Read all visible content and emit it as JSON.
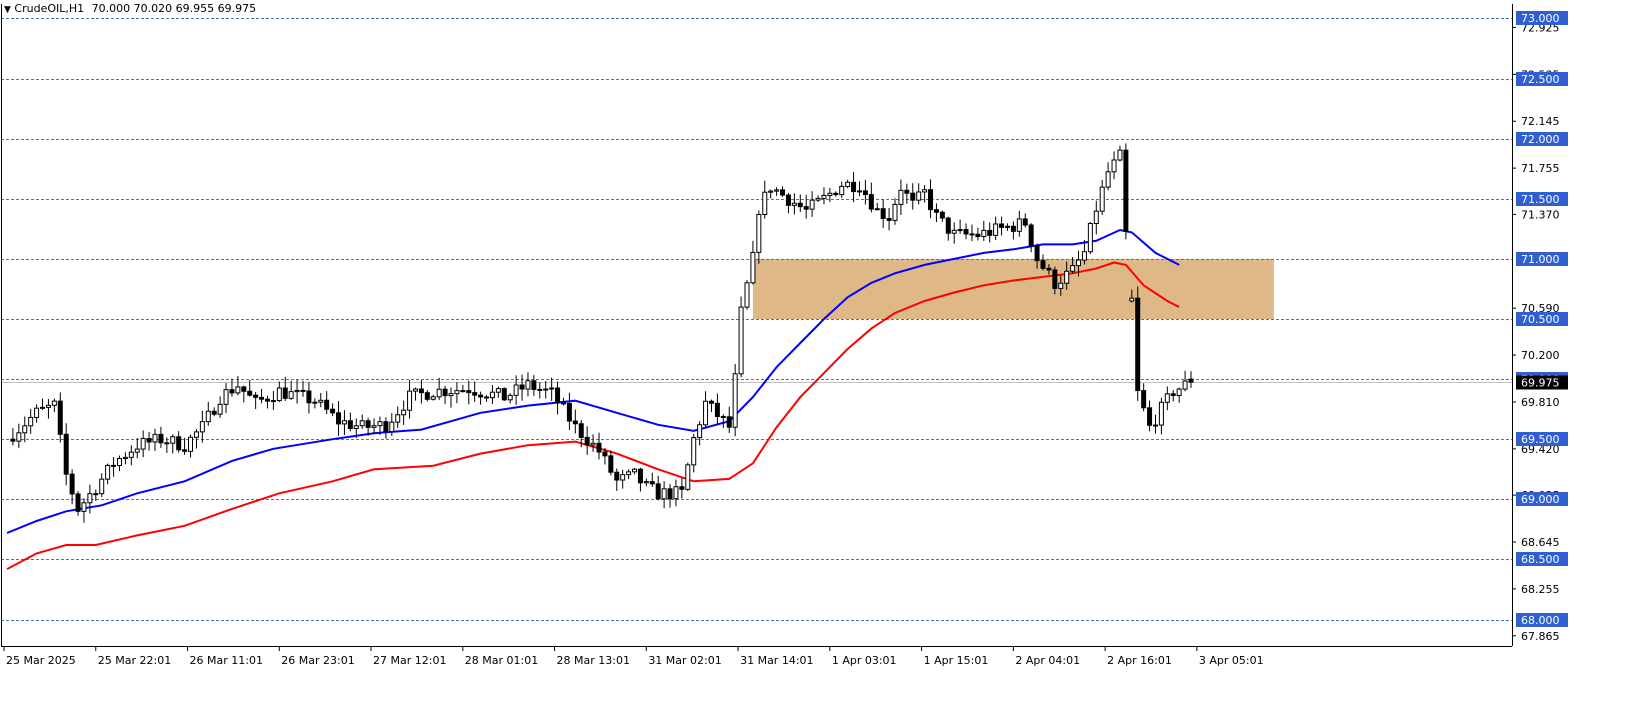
{
  "header": {
    "menu_icon": "triangle-down-icon",
    "symbol": "CrudeOIL,H1",
    "ohlc": "70.000 70.020 69.955 69.975"
  },
  "colors": {
    "background": "#ffffff",
    "grid": "#4472c4",
    "price_label_bg": "#2f5fd0",
    "bull": "#ffffff",
    "bear": "#000000",
    "ema_fast": "#0000ff",
    "ema_slow": "#ff0000",
    "zone": "#deb887"
  },
  "chart_data": {
    "type": "candlestick",
    "symbol": "CrudeOIL",
    "timeframe": "H1",
    "ylim": [
      67.78,
      73.12
    ],
    "grid_levels": [
      73.0,
      72.5,
      72.0,
      71.5,
      71.0,
      70.5,
      70.0,
      69.5,
      69.0,
      68.5,
      68.0
    ],
    "y_ticks": [
      "72.925",
      "72.535",
      "72.145",
      "71.755",
      "71.370",
      "70.590",
      "70.200",
      "69.810",
      "69.420",
      "69.035",
      "68.645",
      "68.255",
      "67.865"
    ],
    "current_price": 69.975,
    "x_ticks": [
      "25 Mar 2025",
      "25 Mar 22:01",
      "26 Mar 11:01",
      "26 Mar 23:01",
      "27 Mar 12:01",
      "28 Mar 01:01",
      "28 Mar 13:01",
      "31 Mar 02:01",
      "31 Mar 14:01",
      "1 Apr 03:01",
      "1 Apr 15:01",
      "2 Apr 04:01",
      "2 Apr 16:01",
      "3 Apr 05:01"
    ],
    "zone": {
      "from_bar": 126,
      "to_bar": 214,
      "low": 70.5,
      "high": 71.0
    },
    "gap_bars": [
      190
    ],
    "waypoints": [
      [
        0,
        69.5
      ],
      [
        5,
        69.72
      ],
      [
        8,
        69.78
      ],
      [
        10,
        69.2
      ],
      [
        12,
        68.92
      ],
      [
        15,
        69.1
      ],
      [
        18,
        69.3
      ],
      [
        22,
        69.45
      ],
      [
        26,
        69.5
      ],
      [
        30,
        69.45
      ],
      [
        33,
        69.6
      ],
      [
        36,
        69.85
      ],
      [
        39,
        69.95
      ],
      [
        42,
        69.8
      ],
      [
        46,
        69.9
      ],
      [
        52,
        69.82
      ],
      [
        56,
        69.65
      ],
      [
        60,
        69.6
      ],
      [
        64,
        69.62
      ],
      [
        68,
        69.85
      ],
      [
        72,
        69.9
      ],
      [
        78,
        69.92
      ],
      [
        84,
        69.85
      ],
      [
        88,
        69.95
      ],
      [
        92,
        69.88
      ],
      [
        96,
        69.6
      ],
      [
        100,
        69.4
      ],
      [
        103,
        69.15
      ],
      [
        106,
        69.2
      ],
      [
        108,
        69.1
      ],
      [
        110,
        69.05
      ],
      [
        114,
        69.05
      ],
      [
        116,
        69.5
      ],
      [
        118,
        69.8
      ],
      [
        120,
        69.7
      ],
      [
        122,
        69.6
      ],
      [
        123,
        70.0
      ],
      [
        124,
        70.55
      ],
      [
        126,
        71.0
      ],
      [
        127,
        71.42
      ],
      [
        129,
        71.6
      ],
      [
        132,
        71.5
      ],
      [
        135,
        71.4
      ],
      [
        138,
        71.5
      ],
      [
        141,
        71.62
      ],
      [
        144,
        71.62
      ],
      [
        147,
        71.4
      ],
      [
        149,
        71.35
      ],
      [
        151,
        71.6
      ],
      [
        153,
        71.45
      ],
      [
        155,
        71.55
      ],
      [
        157,
        71.35
      ],
      [
        160,
        71.2
      ],
      [
        164,
        71.2
      ],
      [
        168,
        71.25
      ],
      [
        172,
        71.3
      ],
      [
        174,
        71.0
      ],
      [
        177,
        70.8
      ],
      [
        180,
        70.9
      ],
      [
        182,
        71.05
      ],
      [
        184,
        71.42
      ],
      [
        186,
        71.72
      ],
      [
        188,
        71.85
      ],
      [
        189,
        71.2
      ],
      [
        190,
        70.65
      ],
      [
        191,
        69.88
      ],
      [
        193,
        69.6
      ],
      [
        195,
        69.75
      ],
      [
        197,
        69.9
      ],
      [
        200,
        69.975
      ]
    ],
    "ema": [
      {
        "name": "",
        "color": "#0000ff",
        "points": [
          [
            0,
            68.72
          ],
          [
            5,
            68.82
          ],
          [
            10,
            68.9
          ],
          [
            16,
            68.95
          ],
          [
            22,
            69.05
          ],
          [
            30,
            69.15
          ],
          [
            38,
            69.32
          ],
          [
            45,
            69.42
          ],
          [
            55,
            69.5
          ],
          [
            62,
            69.55
          ],
          [
            70,
            69.58
          ],
          [
            80,
            69.72
          ],
          [
            88,
            69.78
          ],
          [
            96,
            69.82
          ],
          [
            103,
            69.72
          ],
          [
            110,
            69.62
          ],
          [
            116,
            69.57
          ],
          [
            122,
            69.65
          ],
          [
            126,
            69.85
          ],
          [
            130,
            70.1
          ],
          [
            134,
            70.3
          ],
          [
            138,
            70.5
          ],
          [
            142,
            70.68
          ],
          [
            146,
            70.8
          ],
          [
            150,
            70.88
          ],
          [
            155,
            70.95
          ],
          [
            160,
            71.0
          ],
          [
            165,
            71.05
          ],
          [
            170,
            71.08
          ],
          [
            175,
            71.12
          ],
          [
            180,
            71.12
          ],
          [
            184,
            71.15
          ],
          [
            188,
            71.24
          ],
          [
            190,
            71.22
          ],
          [
            194,
            71.05
          ],
          [
            198,
            70.95
          ]
        ]
      },
      {
        "name": "",
        "color": "#ff0000",
        "points": [
          [
            0,
            68.42
          ],
          [
            5,
            68.55
          ],
          [
            10,
            68.62
          ],
          [
            15,
            68.62
          ],
          [
            22,
            68.7
          ],
          [
            30,
            68.78
          ],
          [
            38,
            68.92
          ],
          [
            46,
            69.05
          ],
          [
            55,
            69.15
          ],
          [
            62,
            69.25
          ],
          [
            72,
            69.28
          ],
          [
            80,
            69.38
          ],
          [
            88,
            69.45
          ],
          [
            96,
            69.48
          ],
          [
            103,
            69.38
          ],
          [
            110,
            69.25
          ],
          [
            116,
            69.15
          ],
          [
            122,
            69.17
          ],
          [
            126,
            69.3
          ],
          [
            130,
            69.6
          ],
          [
            134,
            69.85
          ],
          [
            138,
            70.05
          ],
          [
            142,
            70.25
          ],
          [
            146,
            70.42
          ],
          [
            150,
            70.55
          ],
          [
            155,
            70.65
          ],
          [
            160,
            70.72
          ],
          [
            165,
            70.78
          ],
          [
            170,
            70.82
          ],
          [
            175,
            70.85
          ],
          [
            180,
            70.88
          ],
          [
            184,
            70.92
          ],
          [
            187,
            70.97
          ],
          [
            189,
            70.95
          ],
          [
            192,
            70.78
          ],
          [
            196,
            70.65
          ],
          [
            198,
            70.6
          ]
        ]
      }
    ]
  }
}
